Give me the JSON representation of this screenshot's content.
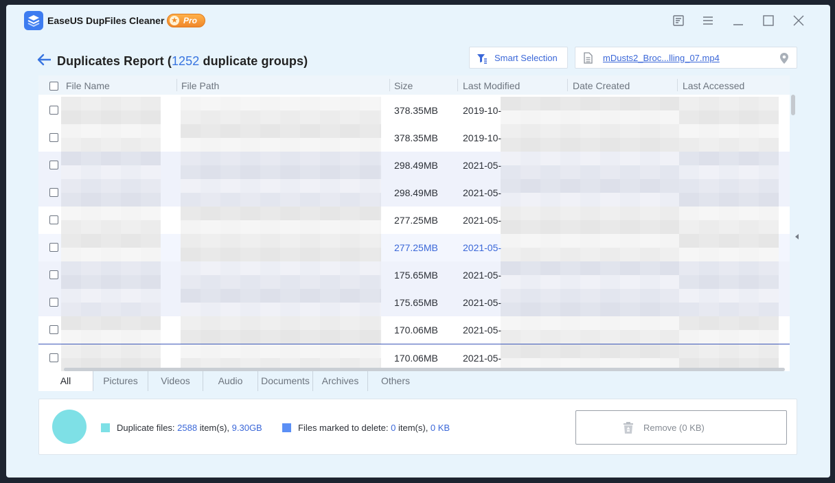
{
  "app": {
    "title": "EaseUS DupFiles Cleaner",
    "badge": "Pro"
  },
  "window_controls": [
    "feedback-icon",
    "menu-icon",
    "minimize-icon",
    "maximize-icon",
    "close-icon"
  ],
  "report": {
    "title_prefix": "Duplicates Report (",
    "group_count": "1252",
    "title_suffix": " duplicate groups)"
  },
  "toolbar": {
    "smart_selection_label": "Smart Selection",
    "current_file": "mDusts2_Broc...lling_07.mp4"
  },
  "table": {
    "columns": [
      "File Name",
      "File Path",
      "Size",
      "Last Modified",
      "Date Created",
      "Last Accessed"
    ],
    "rows": [
      {
        "size": "378.35MB",
        "modified": "2019-10-",
        "group": 1
      },
      {
        "size": "378.35MB",
        "modified": "2019-10-",
        "group": 1
      },
      {
        "size": "298.49MB",
        "modified": "2021-05-",
        "group": 2
      },
      {
        "size": "298.49MB",
        "modified": "2021-05-",
        "group": 2
      },
      {
        "size": "277.25MB",
        "modified": "2021-05-",
        "group": 3
      },
      {
        "size": "277.25MB",
        "modified": "2021-05-",
        "group": 3,
        "highlight": true
      },
      {
        "size": "175.65MB",
        "modified": "2021-05-",
        "group": 4
      },
      {
        "size": "175.65MB",
        "modified": "2021-05-",
        "group": 4
      },
      {
        "size": "170.06MB",
        "modified": "2021-05-",
        "group": 5
      },
      {
        "size": "170.06MB",
        "modified": "2021-05-",
        "group": 5,
        "selected": true
      }
    ]
  },
  "tabs": [
    "All",
    "Pictures",
    "Videos",
    "Audio",
    "Documents",
    "Archives",
    "Others"
  ],
  "active_tab": "All",
  "summary": {
    "duplicate_label": "Duplicate files: ",
    "duplicate_count": "2588",
    "items_text": " item(s), ",
    "duplicate_size": "9.30GB",
    "marked_label": "Files marked to delete: ",
    "marked_count": "0",
    "marked_items_text": " item(s), ",
    "marked_size": "0 KB",
    "remove_label": "Remove (0 KB)"
  },
  "colors": {
    "accent": "#3a67d8",
    "duplicate_legend": "#7ee0e6",
    "marked_legend": "#5b8ff5",
    "row_alt": "#eff2fb"
  }
}
